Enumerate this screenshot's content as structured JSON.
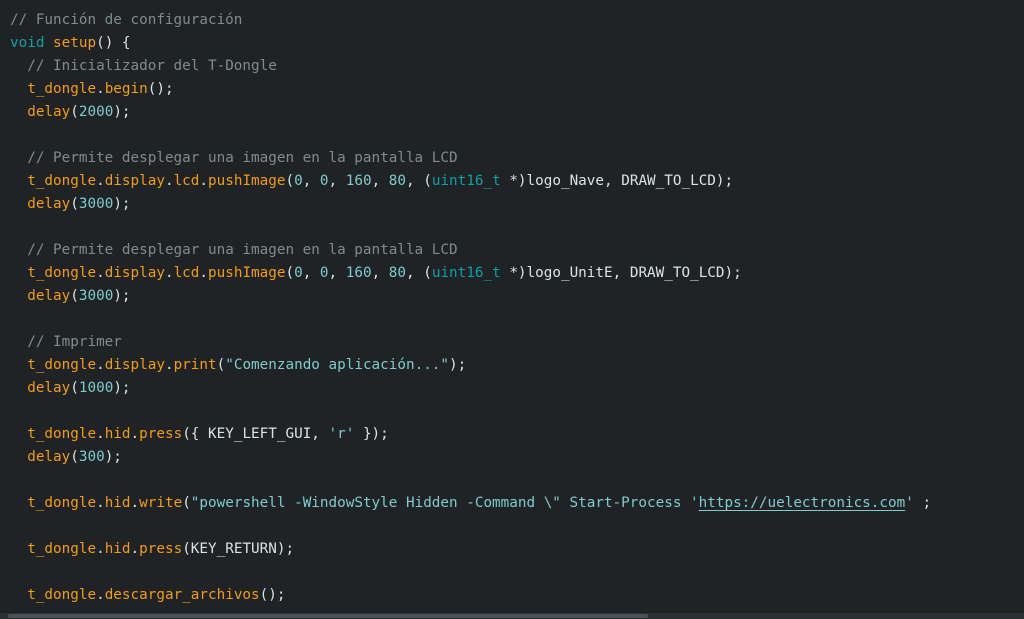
{
  "editor": {
    "lines": [
      [
        {
          "t": "comment",
          "v": "// Función de configuración"
        }
      ],
      [
        {
          "t": "keyword",
          "v": "void"
        },
        {
          "t": "plain",
          "v": " "
        },
        {
          "t": "func",
          "v": "setup"
        },
        {
          "t": "punct",
          "v": "() {"
        }
      ],
      [
        {
          "t": "plain",
          "v": "  "
        },
        {
          "t": "comment",
          "v": "// Inicializador del T-Dongle"
        }
      ],
      [
        {
          "t": "plain",
          "v": "  "
        },
        {
          "t": "ident",
          "v": "t_dongle"
        },
        {
          "t": "punct",
          "v": "."
        },
        {
          "t": "func",
          "v": "begin"
        },
        {
          "t": "punct",
          "v": "();"
        }
      ],
      [
        {
          "t": "plain",
          "v": "  "
        },
        {
          "t": "func",
          "v": "delay"
        },
        {
          "t": "punct",
          "v": "("
        },
        {
          "t": "number",
          "v": "2000"
        },
        {
          "t": "punct",
          "v": ");"
        }
      ],
      [],
      [
        {
          "t": "plain",
          "v": "  "
        },
        {
          "t": "comment",
          "v": "// Permite desplegar una imagen en la pantalla LCD"
        }
      ],
      [
        {
          "t": "plain",
          "v": "  "
        },
        {
          "t": "ident",
          "v": "t_dongle"
        },
        {
          "t": "punct",
          "v": "."
        },
        {
          "t": "ident",
          "v": "display"
        },
        {
          "t": "punct",
          "v": "."
        },
        {
          "t": "ident",
          "v": "lcd"
        },
        {
          "t": "punct",
          "v": "."
        },
        {
          "t": "func",
          "v": "pushImage"
        },
        {
          "t": "punct",
          "v": "("
        },
        {
          "t": "number",
          "v": "0"
        },
        {
          "t": "punct",
          "v": ", "
        },
        {
          "t": "number",
          "v": "0"
        },
        {
          "t": "punct",
          "v": ", "
        },
        {
          "t": "number",
          "v": "160"
        },
        {
          "t": "punct",
          "v": ", "
        },
        {
          "t": "number",
          "v": "80"
        },
        {
          "t": "punct",
          "v": ", ("
        },
        {
          "t": "type",
          "v": "uint16_t"
        },
        {
          "t": "punct",
          "v": " *)logo_Nave, DRAW_TO_LCD);"
        }
      ],
      [
        {
          "t": "plain",
          "v": "  "
        },
        {
          "t": "func",
          "v": "delay"
        },
        {
          "t": "punct",
          "v": "("
        },
        {
          "t": "number",
          "v": "3000"
        },
        {
          "t": "punct",
          "v": ");"
        }
      ],
      [],
      [
        {
          "t": "plain",
          "v": "  "
        },
        {
          "t": "comment",
          "v": "// Permite desplegar una imagen en la pantalla LCD"
        }
      ],
      [
        {
          "t": "plain",
          "v": "  "
        },
        {
          "t": "ident",
          "v": "t_dongle"
        },
        {
          "t": "punct",
          "v": "."
        },
        {
          "t": "ident",
          "v": "display"
        },
        {
          "t": "punct",
          "v": "."
        },
        {
          "t": "ident",
          "v": "lcd"
        },
        {
          "t": "punct",
          "v": "."
        },
        {
          "t": "func",
          "v": "pushImage"
        },
        {
          "t": "punct",
          "v": "("
        },
        {
          "t": "number",
          "v": "0"
        },
        {
          "t": "punct",
          "v": ", "
        },
        {
          "t": "number",
          "v": "0"
        },
        {
          "t": "punct",
          "v": ", "
        },
        {
          "t": "number",
          "v": "160"
        },
        {
          "t": "punct",
          "v": ", "
        },
        {
          "t": "number",
          "v": "80"
        },
        {
          "t": "punct",
          "v": ", ("
        },
        {
          "t": "type",
          "v": "uint16_t"
        },
        {
          "t": "punct",
          "v": " *)logo_UnitE, DRAW_TO_LCD);"
        }
      ],
      [
        {
          "t": "plain",
          "v": "  "
        },
        {
          "t": "func",
          "v": "delay"
        },
        {
          "t": "punct",
          "v": "("
        },
        {
          "t": "number",
          "v": "3000"
        },
        {
          "t": "punct",
          "v": ");"
        }
      ],
      [],
      [
        {
          "t": "plain",
          "v": "  "
        },
        {
          "t": "comment",
          "v": "// Imprimer"
        }
      ],
      [
        {
          "t": "plain",
          "v": "  "
        },
        {
          "t": "ident",
          "v": "t_dongle"
        },
        {
          "t": "punct",
          "v": "."
        },
        {
          "t": "ident",
          "v": "display"
        },
        {
          "t": "punct",
          "v": "."
        },
        {
          "t": "func",
          "v": "print"
        },
        {
          "t": "punct",
          "v": "("
        },
        {
          "t": "string",
          "v": "\"Comenzando aplicación...\""
        },
        {
          "t": "punct",
          "v": ");"
        }
      ],
      [
        {
          "t": "plain",
          "v": "  "
        },
        {
          "t": "func",
          "v": "delay"
        },
        {
          "t": "punct",
          "v": "("
        },
        {
          "t": "number",
          "v": "1000"
        },
        {
          "t": "punct",
          "v": ");"
        }
      ],
      [],
      [
        {
          "t": "plain",
          "v": "  "
        },
        {
          "t": "ident",
          "v": "t_dongle"
        },
        {
          "t": "punct",
          "v": "."
        },
        {
          "t": "ident",
          "v": "hid"
        },
        {
          "t": "punct",
          "v": "."
        },
        {
          "t": "func",
          "v": "press"
        },
        {
          "t": "punct",
          "v": "({ KEY_LEFT_GUI, "
        },
        {
          "t": "string",
          "v": "'r'"
        },
        {
          "t": "punct",
          "v": " });"
        }
      ],
      [
        {
          "t": "plain",
          "v": "  "
        },
        {
          "t": "func",
          "v": "delay"
        },
        {
          "t": "punct",
          "v": "("
        },
        {
          "t": "number",
          "v": "300"
        },
        {
          "t": "punct",
          "v": ");"
        }
      ],
      [],
      [
        {
          "t": "plain",
          "v": "  "
        },
        {
          "t": "ident",
          "v": "t_dongle"
        },
        {
          "t": "punct",
          "v": "."
        },
        {
          "t": "ident",
          "v": "hid"
        },
        {
          "t": "punct",
          "v": "."
        },
        {
          "t": "func",
          "v": "write"
        },
        {
          "t": "punct",
          "v": "("
        },
        {
          "t": "string",
          "v": "\"powershell -WindowStyle Hidden -Command \\\" Start-Process '"
        },
        {
          "t": "link",
          "v": "https://uelectronics.com"
        },
        {
          "t": "string",
          "v": "'"
        },
        {
          "t": "punct",
          "v": " ;"
        }
      ],
      [],
      [
        {
          "t": "plain",
          "v": "  "
        },
        {
          "t": "ident",
          "v": "t_dongle"
        },
        {
          "t": "punct",
          "v": "."
        },
        {
          "t": "ident",
          "v": "hid"
        },
        {
          "t": "punct",
          "v": "."
        },
        {
          "t": "func",
          "v": "press"
        },
        {
          "t": "punct",
          "v": "(KEY_RETURN);"
        }
      ],
      [],
      [
        {
          "t": "plain",
          "v": "  "
        },
        {
          "t": "ident",
          "v": "t_dongle"
        },
        {
          "t": "punct",
          "v": "."
        },
        {
          "t": "func",
          "v": "descargar_archivos"
        },
        {
          "t": "punct",
          "v": "();"
        }
      ]
    ]
  },
  "colors": {
    "background": "#1f2326",
    "comment": "#7f8c8d",
    "keyword": "#0ca1a6",
    "identifier": "#f39c12",
    "number_string": "#7fcbcd",
    "punctuation": "#dae3e3"
  }
}
